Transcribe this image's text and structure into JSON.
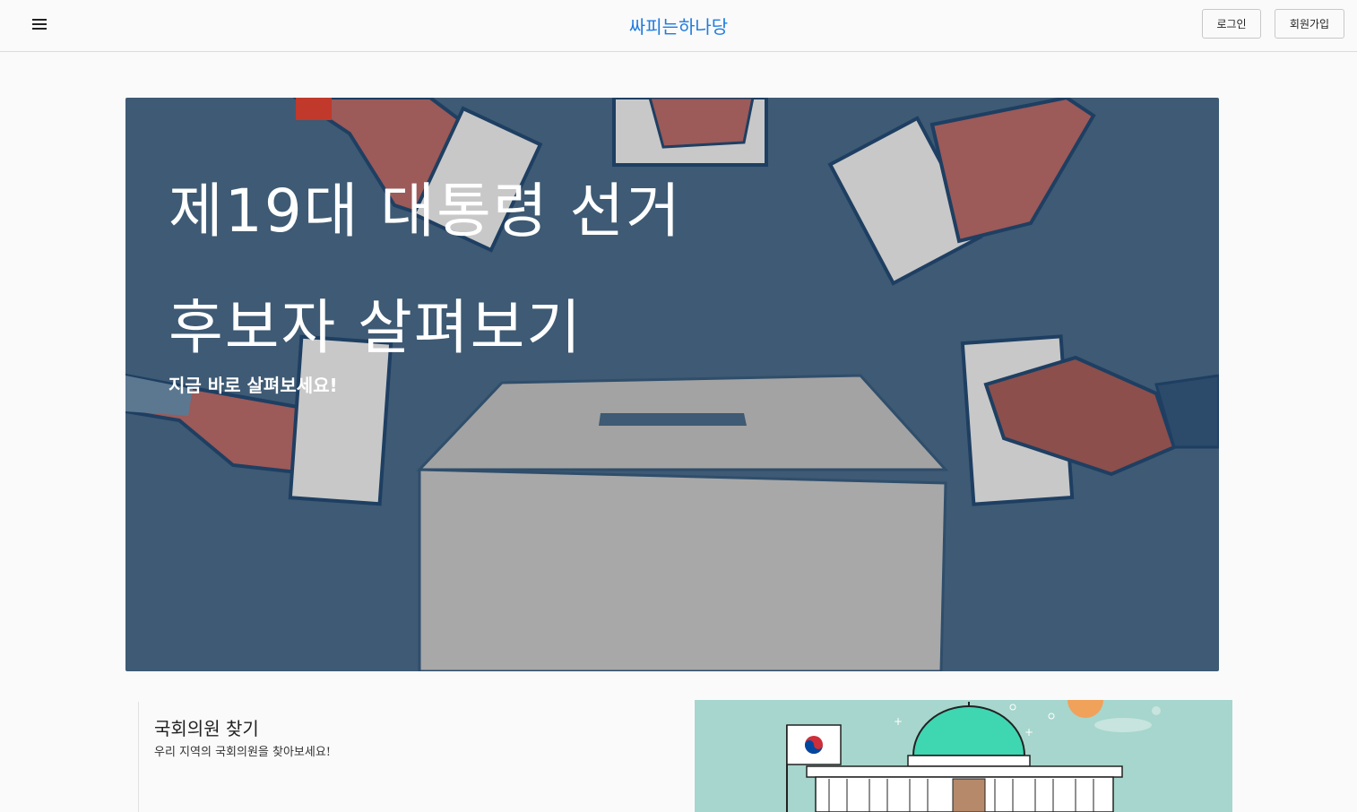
{
  "header": {
    "brand": "싸피는하나당",
    "login_label": "로그인",
    "signup_label": "회원가입"
  },
  "hero": {
    "title_line1": "제19대 대통령 선거",
    "title_line2": "후보자 살펴보기",
    "subtitle": "지금 바로 살펴보세요!"
  },
  "card": {
    "title": "국회의원 찾기",
    "subtitle": "우리 지역의 국회의원을 찾아보세요!"
  },
  "colors": {
    "brand": "#1e7be0",
    "hero_bg": "#3e5a74",
    "card_bg": "#a6d6cd"
  }
}
